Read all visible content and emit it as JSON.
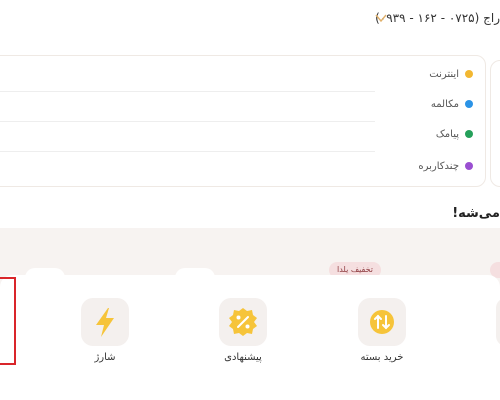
{
  "header": {
    "sim_label": "راج (۰۷۲۵ - ۱۶۲ - ۰۹۳۹)"
  },
  "usage_card": {
    "items": [
      {
        "label": "اینترنت",
        "color": "#f2b731"
      },
      {
        "label": "مکالمه",
        "color": "#2b93e6"
      },
      {
        "label": "پیامک",
        "color": "#25a05a"
      },
      {
        "label": "چندکاربره",
        "color": "#9a4fd1"
      }
    ]
  },
  "banner": {
    "text": "می‌شه!"
  },
  "services": {
    "discount_badge": "تخفیف یلدا",
    "items": [
      {
        "label": "شارژ",
        "icon": "lightning-icon"
      },
      {
        "label": "پیشنهادی",
        "icon": "discount-percent-icon"
      },
      {
        "label": "خرید بسته",
        "icon": "package-arrows-icon"
      }
    ]
  },
  "colors": {
    "accent": "#f2b731",
    "focus_outline": "#d9252a"
  }
}
